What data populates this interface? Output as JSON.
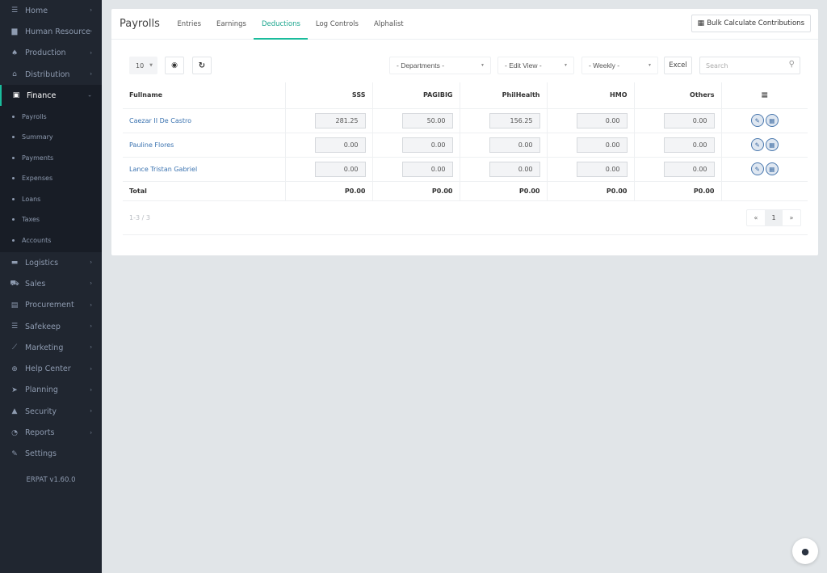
{
  "sidebar": {
    "items": [
      {
        "label": "Home",
        "icon": "home-icon",
        "glyph": "☰"
      },
      {
        "label": "Human Resource",
        "icon": "briefcase-icon",
        "glyph": "▆"
      },
      {
        "label": "Production",
        "icon": "flask-icon",
        "glyph": "♠"
      },
      {
        "label": "Distribution",
        "icon": "bank-icon",
        "glyph": "⌂"
      },
      {
        "label": "Finance",
        "icon": "money-icon",
        "glyph": "▣"
      }
    ],
    "finance_subitems": [
      "Payrolls",
      "Summary",
      "Payments",
      "Expenses",
      "Loans",
      "Taxes",
      "Accounts"
    ],
    "items_after": [
      {
        "label": "Logistics",
        "icon": "truck-icon",
        "glyph": "▬"
      },
      {
        "label": "Sales",
        "icon": "cart-icon",
        "glyph": "⛟"
      },
      {
        "label": "Procurement",
        "icon": "bag-icon",
        "glyph": "▤"
      },
      {
        "label": "Safekeep",
        "icon": "list-icon",
        "glyph": "☰"
      },
      {
        "label": "Marketing",
        "icon": "line-chart-icon",
        "glyph": "⟋"
      },
      {
        "label": "Help Center",
        "icon": "life-ring-icon",
        "glyph": "⊕"
      },
      {
        "label": "Planning",
        "icon": "paper-plane-icon",
        "glyph": "➤"
      },
      {
        "label": "Security",
        "icon": "lock-icon",
        "glyph": "▲"
      },
      {
        "label": "Reports",
        "icon": "pie-chart-icon",
        "glyph": "◔"
      },
      {
        "label": "Settings",
        "icon": "wrench-icon",
        "glyph": "✎"
      }
    ],
    "version": "ERPAT v1.60.0",
    "chevron": "›",
    "chevron_down": "⌄"
  },
  "header": {
    "title": "Payrolls",
    "tabs": [
      "Entries",
      "Earnings",
      "Deductions",
      "Log Controls",
      "Alphalist"
    ],
    "active_tab": "Deductions",
    "bulk_button": "Bulk Calculate Contributions",
    "accent": "#1abc9c"
  },
  "toolbar": {
    "page_size": "10",
    "departments": "- Departments -",
    "edit_view": "- Edit View -",
    "period": "- Weekly -",
    "excel": "Excel",
    "search_placeholder": "Search"
  },
  "table": {
    "columns": [
      "Fullname",
      "SSS",
      "PAGIBIG",
      "PhilHealth",
      "HMO",
      "Others"
    ],
    "menu_icon": "≡",
    "rows": [
      {
        "name": "Caezar II De Castro",
        "values": [
          "281.25",
          "50.00",
          "156.25",
          "0.00",
          "0.00"
        ]
      },
      {
        "name": "Pauline Flores",
        "values": [
          "0.00",
          "0.00",
          "0.00",
          "0.00",
          "0.00"
        ]
      },
      {
        "name": "Lance Tristan Gabriel",
        "values": [
          "0.00",
          "0.00",
          "0.00",
          "0.00",
          "0.00"
        ]
      }
    ],
    "total_label": "Total",
    "totals": [
      "P0.00",
      "P0.00",
      "P0.00",
      "P0.00",
      "P0.00"
    ]
  },
  "footer": {
    "count": "1-3 / 3",
    "prev": "«",
    "page": "1",
    "next": "»"
  }
}
